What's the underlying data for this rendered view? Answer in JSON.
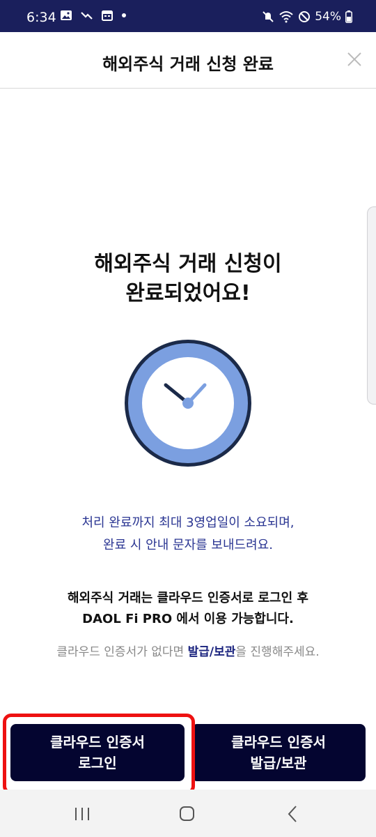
{
  "status_bar": {
    "time": "6:34",
    "battery": "54%",
    "left_icons": [
      "image-icon",
      "missed-call-icon",
      "calendar-icon",
      "dot-icon"
    ],
    "right_icons": [
      "mute-icon",
      "wifi-icon",
      "do-not-disturb-icon",
      "battery-icon"
    ]
  },
  "header": {
    "title": "해외주식 거래 신청 완료",
    "close_icon": "close-icon"
  },
  "main": {
    "title_line1": "해외주식 거래 신청이",
    "title_line2": "완료되었어요!",
    "clock_icon": "clock-icon",
    "info_line1": "처리 완료까지 최대 3영업일이 소요되며,",
    "info_line2": "완료 시 안내 문자를 보내드려요.",
    "notice_line1": "해외주식 거래는 클라우드 인증서로 로그인 후",
    "notice_line2": "DAOL Fi PRO 에서 이용 가능합니다.",
    "sub_prefix": "클라우드 인증서가 없다면 ",
    "sub_bold": "발급/보관",
    "sub_suffix": "을 진행해주세요."
  },
  "buttons": {
    "login_line1": "클라우드 인증서",
    "login_line2": "로그인",
    "issue_line1": "클라우드 인증서",
    "issue_line2": "발급/보관"
  },
  "colors": {
    "status_bar": "#1a1f5c",
    "button_bg": "#040530",
    "accent_text": "#2a3592",
    "clock_fill": "#7b9fe0",
    "clock_ring": "#1b2a49",
    "highlight": "#ee1111"
  },
  "nav_bar": {
    "icons": [
      "recent-apps-icon",
      "home-icon",
      "back-icon"
    ]
  }
}
